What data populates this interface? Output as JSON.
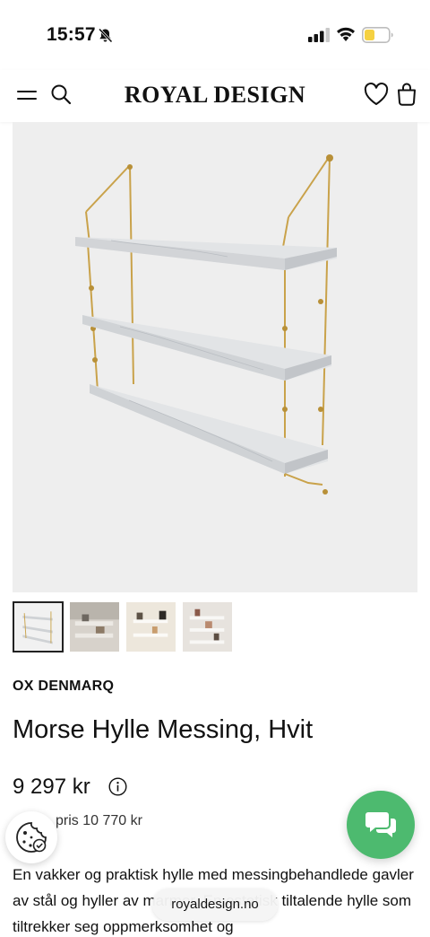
{
  "status_bar": {
    "time": "15:57"
  },
  "header": {
    "brand": "ROYAL DESIGN"
  },
  "product": {
    "brand": "OX DENMARQ",
    "title": "Morse Hylle Messing, Hvit",
    "price": "9 297 kr",
    "previous_price_label": "pris 10 770 kr",
    "description": "En vakker og praktisk hylle med messingbehandlede gavler av stål og hyller av marmor. En estetisk tiltalende hylle som tiltrekker seg oppmerksomhet og",
    "thumbnails": [
      {
        "label": "thumbnail-1",
        "active": true
      },
      {
        "label": "thumbnail-2",
        "active": false
      },
      {
        "label": "thumbnail-3",
        "active": false
      },
      {
        "label": "thumbnail-4",
        "active": false
      }
    ]
  },
  "browser": {
    "url": "royaldesign.no"
  },
  "icons": {
    "status": [
      "bell-slash-icon",
      "signal-icon",
      "wifi-icon",
      "battery-icon"
    ],
    "header": [
      "menu-icon",
      "search-icon",
      "heart-icon",
      "shopping-bag-icon"
    ],
    "floating": [
      "cookie-icon",
      "chat-icon",
      "info-icon"
    ]
  },
  "colors": {
    "chat_button": "#4dba6f",
    "battery": "#f5d142",
    "image_background": "#eeeeee",
    "brass": "#c9a24a"
  }
}
